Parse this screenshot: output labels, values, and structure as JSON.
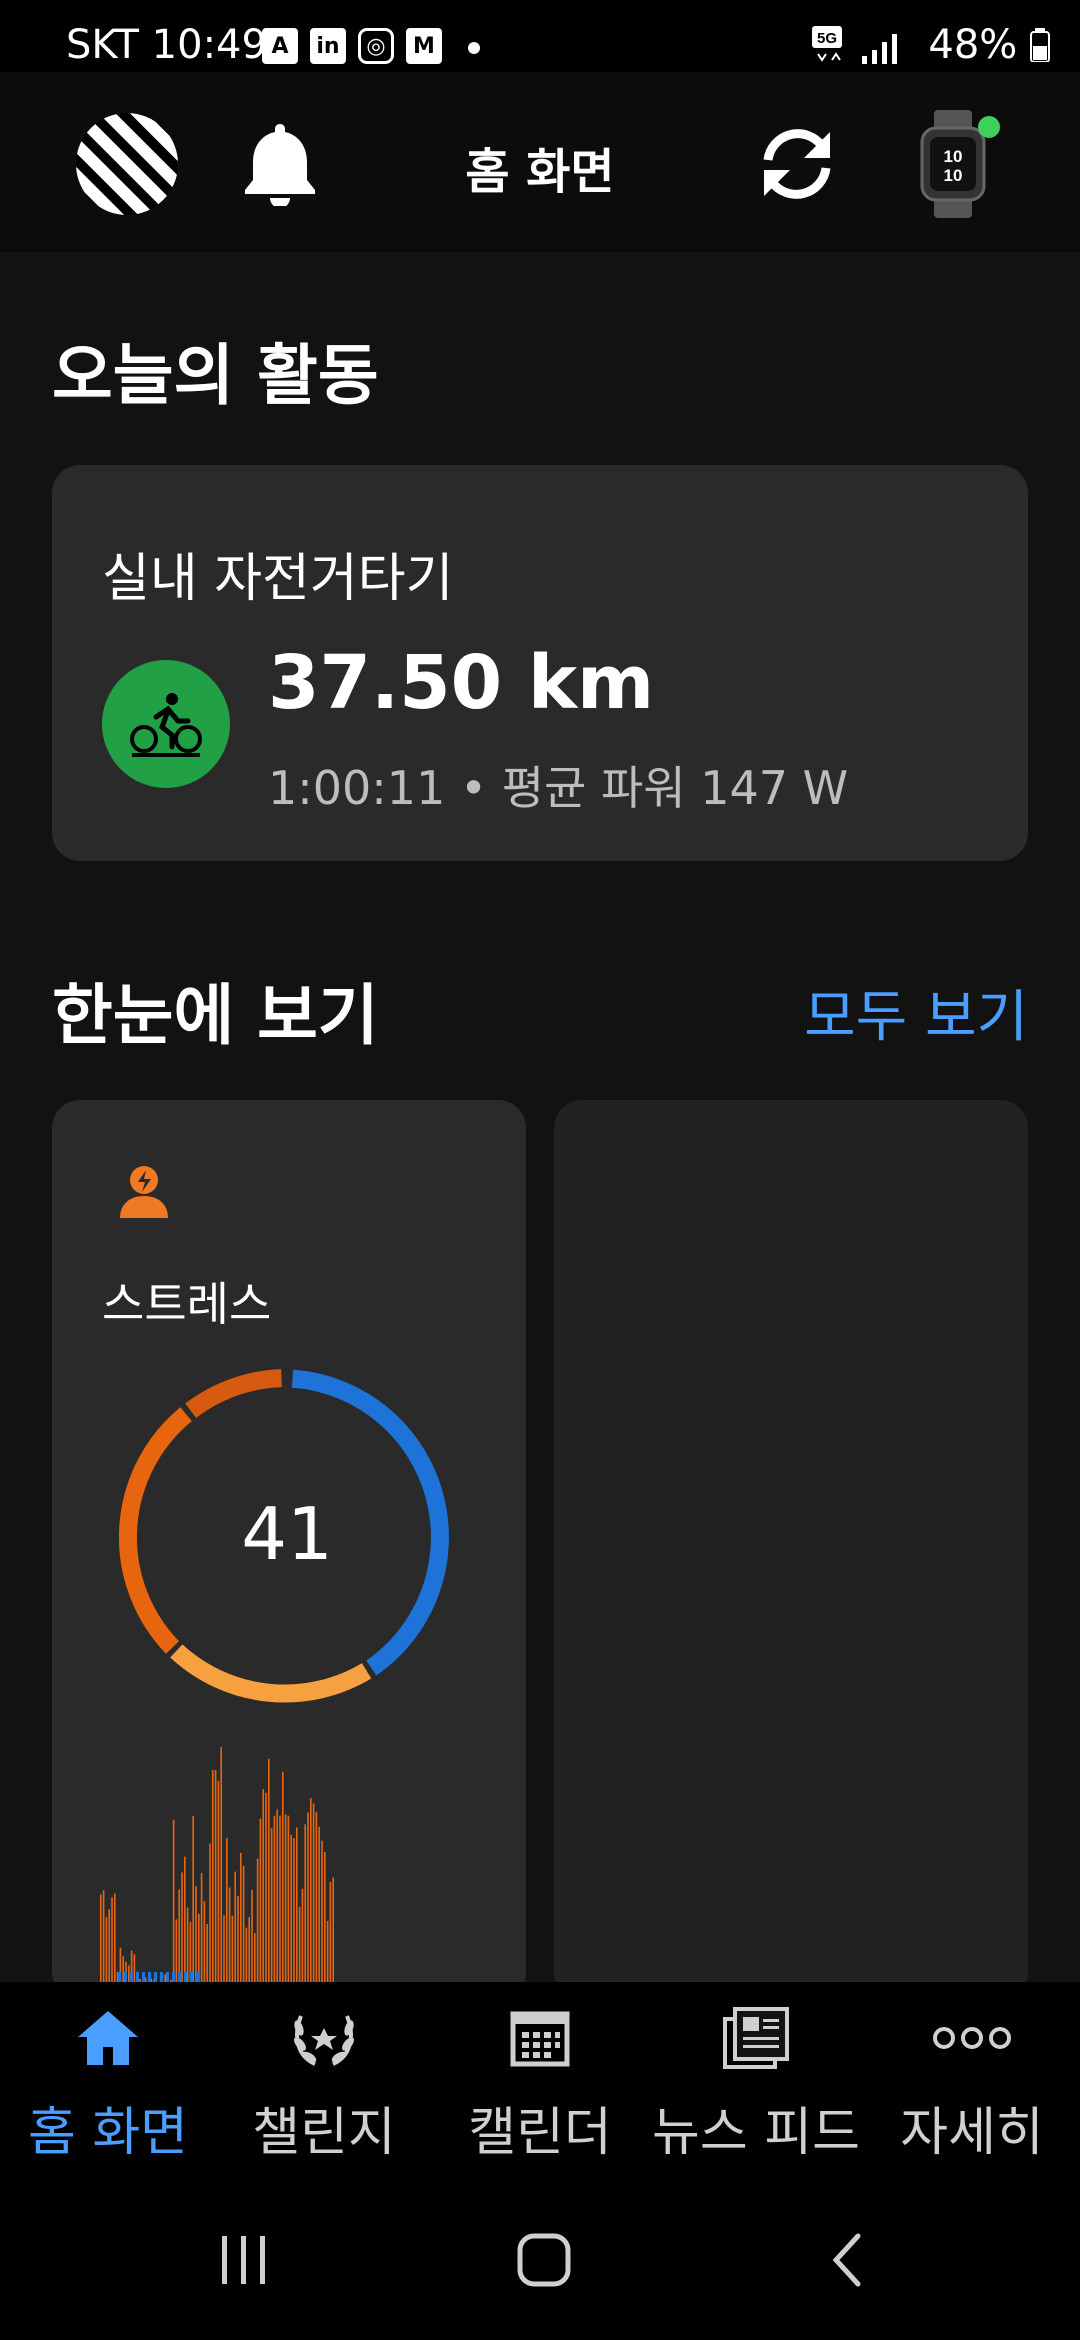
{
  "status_bar": {
    "carrier_time": "SKT 10:49",
    "notification_icons": [
      "translate-icon",
      "linkedin-icon",
      "instagram-icon",
      "gmail-icon"
    ],
    "right_text": "48%"
  },
  "header": {
    "title": "홈 화면"
  },
  "today": {
    "section_title": "오늘의 활동",
    "activity": {
      "name": "실내 자전거타기",
      "distance": "37.50 km",
      "meta": "1:00:11 • 평균 파워 147 W",
      "icon": "cycling-icon",
      "icon_color": "#22a045"
    }
  },
  "glance": {
    "section_title": "한눈에 보기",
    "view_all": "모두 보기",
    "stress": {
      "label": "스트레스",
      "value": "41",
      "ring_colors": {
        "rest": "#1e73d8",
        "low": "#f7a040",
        "medium": "#e8650f",
        "high": "#d85a10"
      }
    }
  },
  "nav": {
    "items": [
      {
        "label": "홈 화면",
        "icon": "home-icon",
        "active": true
      },
      {
        "label": "챌린지",
        "icon": "laurel-icon",
        "active": false
      },
      {
        "label": "캘린더",
        "icon": "calendar-icon",
        "active": false
      },
      {
        "label": "뉴스 피드",
        "icon": "newsfeed-icon",
        "active": false
      },
      {
        "label": "자세히",
        "icon": "more-icon",
        "active": false
      }
    ]
  },
  "colors": {
    "accent": "#4a9eff",
    "background": "#121212",
    "card": "#2a2a2a"
  }
}
